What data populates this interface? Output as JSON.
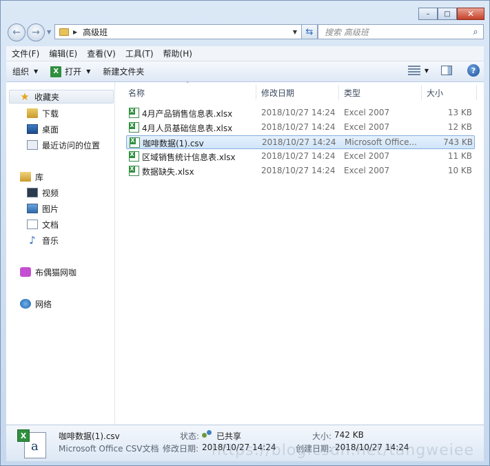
{
  "window": {
    "controls": {
      "minimize": "–",
      "maximize": "□",
      "close": "✕"
    }
  },
  "nav": {
    "address_path": "高级班",
    "search_placeholder": "搜索 高级班"
  },
  "menu": [
    "文件(F)",
    "编辑(E)",
    "查看(V)",
    "工具(T)",
    "帮助(H)"
  ],
  "toolbar": {
    "organize": "组织",
    "open": "打开",
    "new_folder": "新建文件夹"
  },
  "sidebar": {
    "favorites": {
      "label": "收藏夹",
      "items": [
        "下载",
        "桌面",
        "最近访问的位置"
      ]
    },
    "libraries": {
      "label": "库",
      "items": [
        "视频",
        "图片",
        "文档",
        "音乐"
      ]
    },
    "homegroup": "布偶猫网咖",
    "network": "网络"
  },
  "columns": {
    "name": "名称",
    "date": "修改日期",
    "type": "类型",
    "size": "大小"
  },
  "files": [
    {
      "name": "4月产品销售信息表.xlsx",
      "date": "2018/10/27 14:24",
      "type": "Excel 2007",
      "size": "13 KB"
    },
    {
      "name": "4月人员基础信息表.xlsx",
      "date": "2018/10/27 14:24",
      "type": "Excel 2007",
      "size": "12 KB"
    },
    {
      "name": "咖啡数据(1).csv",
      "date": "2018/10/27 14:24",
      "type": "Microsoft Office...",
      "size": "743 KB"
    },
    {
      "name": "区域销售统计信息表.xlsx",
      "date": "2018/10/27 14:24",
      "type": "Excel 2007",
      "size": "11 KB"
    },
    {
      "name": "数据缺失.xlsx",
      "date": "2018/10/27 14:24",
      "type": "Excel 2007",
      "size": "10 KB"
    }
  ],
  "selected_index": 2,
  "details": {
    "filename": "咖啡数据(1).csv",
    "filetype": "Microsoft Office CSV文档",
    "state_label": "状态:",
    "state_value": "已共享",
    "modified_label": "修改日期:",
    "modified_value": "2018/10/27 14:24",
    "size_label": "大小:",
    "size_value": "742 KB",
    "created_label": "创建日期:",
    "created_value": "2018/10/27 14:24"
  },
  "watermark": "https://blog.csdn.net/tangweiee"
}
